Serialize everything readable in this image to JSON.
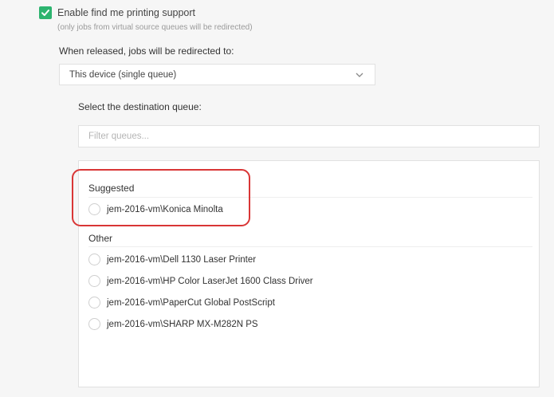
{
  "find_me": {
    "checkbox_checked": true,
    "label": "Enable find me printing support",
    "hint": "(only jobs from virtual source queues will be redirected)",
    "accent_color": "#2db46f"
  },
  "redirect": {
    "label": "When released, jobs will be redirected to:",
    "selected": "This device (single queue)"
  },
  "destination": {
    "label": "Select the destination queue:",
    "filter_placeholder": "Filter queues...",
    "filter_value": ""
  },
  "groups": {
    "suggested": {
      "heading": "Suggested",
      "items": [
        {
          "label": "jem-2016-vm\\Konica Minolta"
        }
      ]
    },
    "other": {
      "heading": "Other",
      "items": [
        {
          "label": "jem-2016-vm\\Dell 1130 Laser Printer"
        },
        {
          "label": "jem-2016-vm\\HP Color LaserJet 1600 Class Driver"
        },
        {
          "label": "jem-2016-vm\\PaperCut Global PostScript"
        },
        {
          "label": "jem-2016-vm\\SHARP MX-M282N PS"
        }
      ]
    }
  },
  "annotation": {
    "highlight_color": "#d93636"
  }
}
